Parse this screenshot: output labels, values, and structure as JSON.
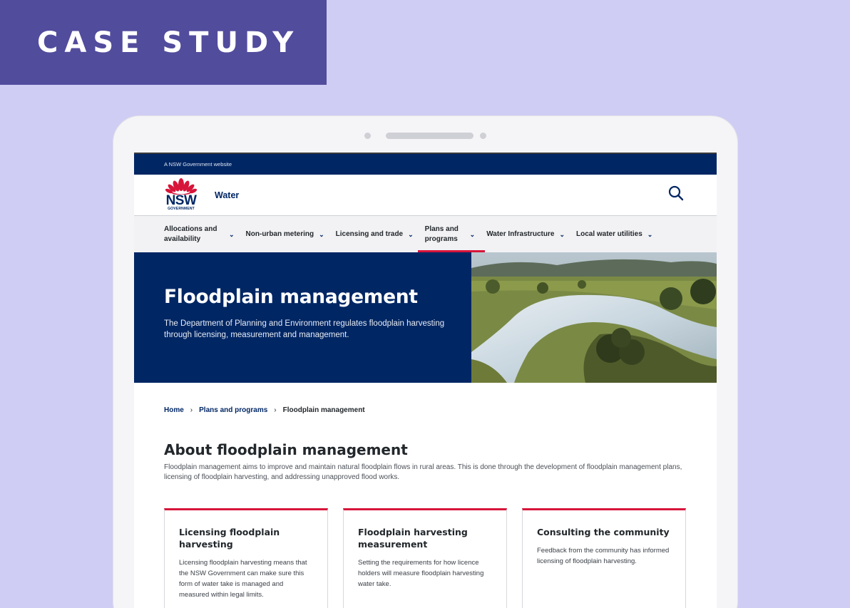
{
  "banner": {
    "label": "CASE STUDY"
  },
  "site": {
    "gov_bar_text": "A NSW Government website",
    "logo_text": "NSW",
    "logo_subtext": "GOVERNMENT",
    "name": "Water"
  },
  "nav": {
    "items": [
      {
        "label": "Allocations and availability"
      },
      {
        "label": "Non-urban metering"
      },
      {
        "label": "Licensing and trade"
      },
      {
        "label": "Plans and programs"
      },
      {
        "label": "Water Infrastructure"
      },
      {
        "label": "Local water utilities"
      }
    ]
  },
  "hero": {
    "title": "Floodplain management",
    "description": "The Department of Planning and Environment regulates floodplain harvesting through licensing, measurement and management."
  },
  "breadcrumb": {
    "home": "Home",
    "parent": "Plans and programs",
    "current": "Floodplain management"
  },
  "about": {
    "title": "About floodplain management",
    "description": "Floodplain management aims to improve and maintain natural floodplain flows in rural areas. This is done through the development of floodplain management plans, licensing of floodplain harvesting, and addressing unapproved flood works."
  },
  "cards": [
    {
      "title": "Licensing floodplain harvesting",
      "description": "Licensing floodplain harvesting means that the NSW Government can make sure this form of water take is managed and measured within legal limits."
    },
    {
      "title": "Floodplain harvesting measurement",
      "description": "Setting the requirements for how licence holders will measure floodplain harvesting water take."
    },
    {
      "title": "Consulting the community",
      "description": "Feedback from the community has informed licensing of floodplain harvesting."
    }
  ],
  "colors": {
    "background": "#cfcdf4",
    "banner": "#524c9d",
    "navy": "#002664",
    "accent_red": "#d7153a"
  },
  "icons": [
    "waratah-logo-icon",
    "search-icon",
    "chevron-down-icon",
    "chevron-right-icon"
  ]
}
